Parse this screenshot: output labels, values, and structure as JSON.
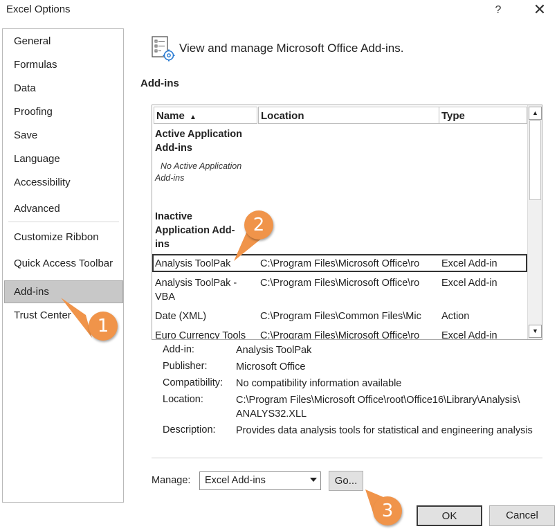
{
  "window": {
    "title": "Excel Options",
    "help_label": "?",
    "close_label": "✕"
  },
  "sidebar": {
    "items": [
      {
        "label": "General"
      },
      {
        "label": "Formulas"
      },
      {
        "label": "Data"
      },
      {
        "label": "Proofing"
      },
      {
        "label": "Save"
      },
      {
        "label": "Language"
      },
      {
        "label": "Accessibility"
      },
      {
        "label": "Advanced"
      },
      {
        "label": "Customize Ribbon"
      },
      {
        "label": "Quick Access Toolbar"
      },
      {
        "label": "Add-ins",
        "selected": true
      },
      {
        "label": "Trust Center"
      }
    ]
  },
  "main": {
    "header_text": "View and manage Microsoft Office Add-ins.",
    "header_icon": "add-ins-settings-icon",
    "section_title": "Add-ins",
    "table": {
      "columns": {
        "name": "Name",
        "name_sort_indicator": "▲",
        "location": "Location",
        "type": "Type"
      },
      "active_group": {
        "header_line1": "Active Application",
        "header_line2": "Add-ins",
        "note_line1": "No Active Application",
        "note_line2": "Add-ins"
      },
      "inactive_group": {
        "header_line1": "Inactive",
        "header_line2": "Application Add-",
        "header_line3": "ins"
      },
      "rows": [
        {
          "name": "Analysis ToolPak",
          "location": "C:\\Program Files\\Microsoft Office\\ro",
          "type": "Excel Add-in",
          "selected": true
        },
        {
          "name_line1": "Analysis ToolPak -",
          "name_line2": "VBA",
          "location": "C:\\Program Files\\Microsoft Office\\ro",
          "type": "Excel Add-in"
        },
        {
          "name": "Date (XML)",
          "location": "C:\\Program Files\\Common Files\\Mic",
          "type": "Action"
        },
        {
          "name": "Euro Currency Tools",
          "location": "C:\\Program Files\\Microsoft Office\\ro",
          "type": "Excel Add-in"
        }
      ],
      "scroll_up": "▲",
      "scroll_down": "▼"
    },
    "details": {
      "addin_label": "Add-in:",
      "addin_value": "Analysis ToolPak",
      "publisher_label": "Publisher:",
      "publisher_value": "Microsoft Office",
      "compatibility_label": "Compatibility:",
      "compatibility_value": "No compatibility information available",
      "location_label": "Location:",
      "location_value_line1": "C:\\Program Files\\Microsoft Office\\root\\Office16\\Library\\Analysis\\",
      "location_value_line2": "ANALYS32.XLL",
      "description_label": "Description:",
      "description_value": "Provides data analysis tools for statistical and engineering analysis"
    },
    "manage": {
      "label": "Manage:",
      "selected": "Excel Add-ins",
      "go_label": "Go..."
    }
  },
  "footer": {
    "ok_label": "OK",
    "cancel_label": "Cancel"
  },
  "callouts": {
    "step1": "1",
    "step2": "2",
    "step3": "3",
    "color": "#f0944a"
  }
}
